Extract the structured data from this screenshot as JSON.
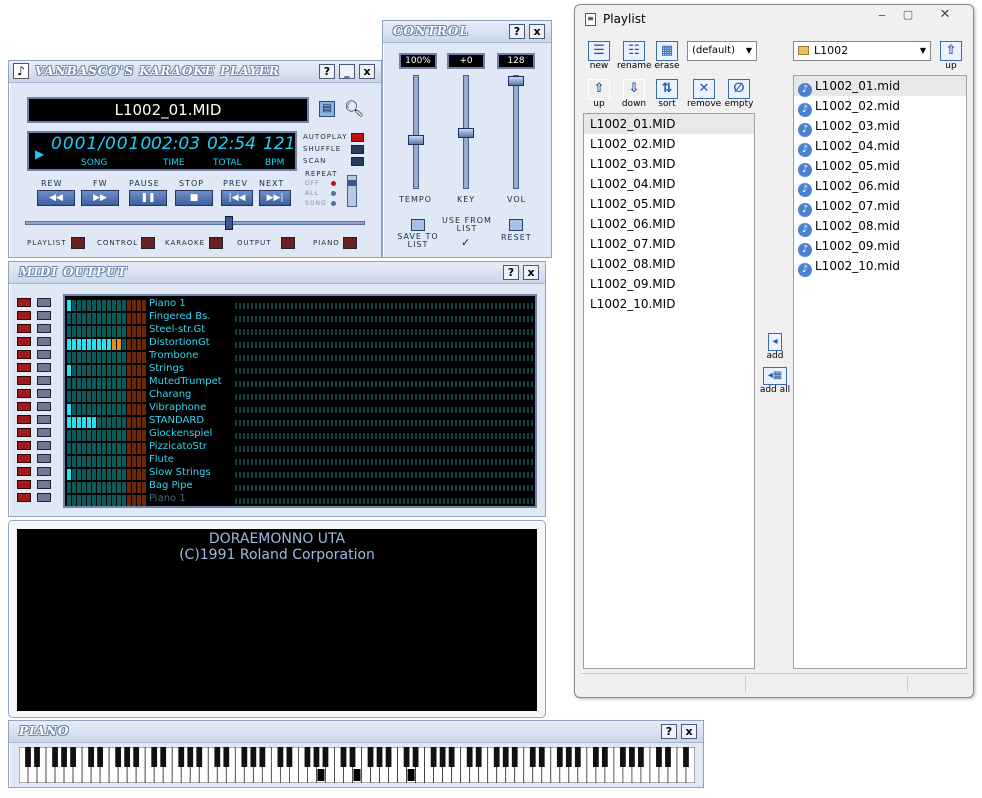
{
  "player": {
    "title": "VANBASCO'S KARAOKE PLAYER",
    "help": "?",
    "min": "_",
    "close": "x",
    "filename": "L1002_01.MID",
    "song": "0001/0010",
    "song_label": "SONG",
    "time": "02:03",
    "time_label": "TIME",
    "total": "02:54",
    "total_label": "TOTAL",
    "bpm": "121",
    "bpm_label": "BPM",
    "autoplay": "Autoplay",
    "shuffle": "Shuffle",
    "scan": "Scan",
    "repeat": "Repeat",
    "off": "Off",
    "all": "All",
    "songopt": "Song",
    "rew": "Rew",
    "fw": "Fw",
    "pause": "Pause",
    "stop": "Stop",
    "prev": "Prev",
    "next": "Next",
    "rew_sym": "◀◀",
    "fw_sym": "▶▶",
    "pause_sym": "❚❚",
    "stop_sym": "■",
    "prev_sym": "|◀◀",
    "next_sym": "▶▶|",
    "position": 0.6,
    "toggles": [
      "Playlist",
      "Control",
      "Karaoke",
      "Output",
      "Piano"
    ]
  },
  "control": {
    "title": "CONTROL",
    "help": "?",
    "close": "x",
    "tempo_val": "100%",
    "key_val": "+0",
    "vol_val": "128",
    "tempo": "Tempo",
    "key": "Key",
    "vol": "Vol",
    "save": "Save to List",
    "use": "Use from List",
    "reset": "Reset",
    "tempo_level": 0.43,
    "key_level": 0.5,
    "vol_level": 1.0
  },
  "midi": {
    "title": "MIDI OUTPUT",
    "help": "?",
    "close": "x",
    "channels": [
      {
        "name": "Piano 1",
        "level": 1
      },
      {
        "name": "Fingered Bs.",
        "level": 0
      },
      {
        "name": "Steel-str.Gt",
        "level": 0
      },
      {
        "name": "DistortionGt",
        "level": 11
      },
      {
        "name": "Trombone",
        "level": 0
      },
      {
        "name": "Strings",
        "level": 1
      },
      {
        "name": "MutedTrumpet",
        "level": 0
      },
      {
        "name": "Charang",
        "level": 0
      },
      {
        "name": "Vibraphone",
        "level": 1
      },
      {
        "name": "STANDARD",
        "level": 6
      },
      {
        "name": "Glockenspiel",
        "level": 0
      },
      {
        "name": "PizzicatoStr",
        "level": 0
      },
      {
        "name": "Flute",
        "level": 0
      },
      {
        "name": "Slow Strings",
        "level": 1
      },
      {
        "name": "Bag Pipe",
        "level": 0
      },
      {
        "name": "Piano 1",
        "level": 0
      }
    ]
  },
  "karaoke": {
    "line1": "DORAEMONNO UTA",
    "line2": "(C)1991 Roland Corporation"
  },
  "piano": {
    "title": "PIANO",
    "help": "?",
    "close": "x"
  },
  "playlist": {
    "title": "Playlist",
    "new": "new",
    "rename": "rename",
    "erase": "erase",
    "list_name": "(default)",
    "folder": "L1002",
    "up_folder": "up",
    "up": "up",
    "down": "down",
    "sort": "sort",
    "remove": "remove",
    "empty": "empty",
    "add": "add",
    "add_all": "add all",
    "items": [
      "L1002_01.MID",
      "L1002_02.MID",
      "L1002_03.MID",
      "L1002_04.MID",
      "L1002_05.MID",
      "L1002_06.MID",
      "L1002_07.MID",
      "L1002_08.MID",
      "L1002_09.MID",
      "L1002_10.MID"
    ],
    "files": [
      "L1002_01.mid",
      "L1002_02.mid",
      "L1002_03.mid",
      "L1002_04.mid",
      "L1002_05.mid",
      "L1002_06.mid",
      "L1002_07.mid",
      "L1002_08.mid",
      "L1002_09.mid",
      "L1002_10.mid"
    ]
  }
}
